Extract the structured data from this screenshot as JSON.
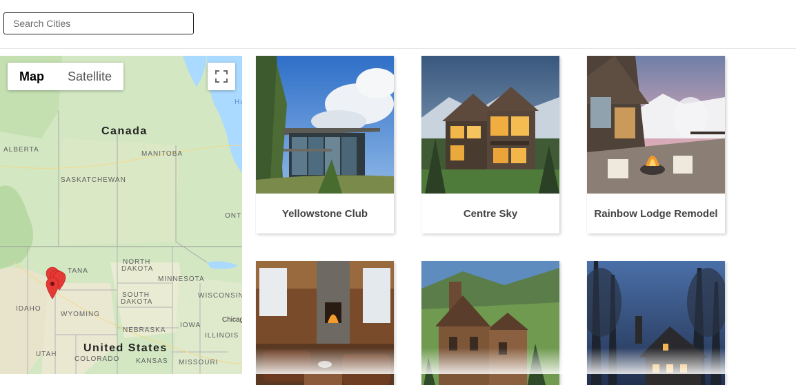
{
  "search": {
    "placeholder": "Search Cities",
    "value": ""
  },
  "map": {
    "toggle": {
      "map_label": "Map",
      "satellite_label": "Satellite",
      "selected": "Map"
    },
    "fullscreen_icon": "fullscreen-icon",
    "labels": {
      "canada": "Canada",
      "united_states": "United States",
      "alberta": "ALBERTA",
      "manitoba": "MANITOBA",
      "saskatchewan": "SASKATCHEWAN",
      "ontario": "ONT",
      "north_dakota_1": "NORTH",
      "north_dakota_2": "DAKOTA",
      "south_dakota_1": "SOUTH",
      "south_dakota_2": "DAKOTA",
      "minnesota": "MINNESOTA",
      "wisconsin": "WISCONSIN",
      "montana": "TANA",
      "idaho": "IDAHO",
      "wyoming": "WYOMING",
      "nebraska": "NEBRASKA",
      "iowa": "IOWA",
      "illinois": "ILLINOIS",
      "utah": "UTAH",
      "colorado": "COLORADO",
      "kansas": "KANSAS",
      "missouri": "MISSOURI",
      "chicago": "Chicag",
      "hudson_bay": "Hu"
    },
    "marker_color": "#e53935",
    "marker_count": 4
  },
  "listings": [
    {
      "title": "Yellowstone Club",
      "scene": "modern-glass-house"
    },
    {
      "title": "Centre Sky",
      "scene": "lit-mountain-lodge"
    },
    {
      "title": "Rainbow Lodge Remodel",
      "scene": "patio-fire-pit"
    },
    {
      "title": "",
      "scene": "log-cabin-interior"
    },
    {
      "title": "",
      "scene": "wood-barn-house"
    },
    {
      "title": "",
      "scene": "cabin-at-dusk"
    }
  ]
}
